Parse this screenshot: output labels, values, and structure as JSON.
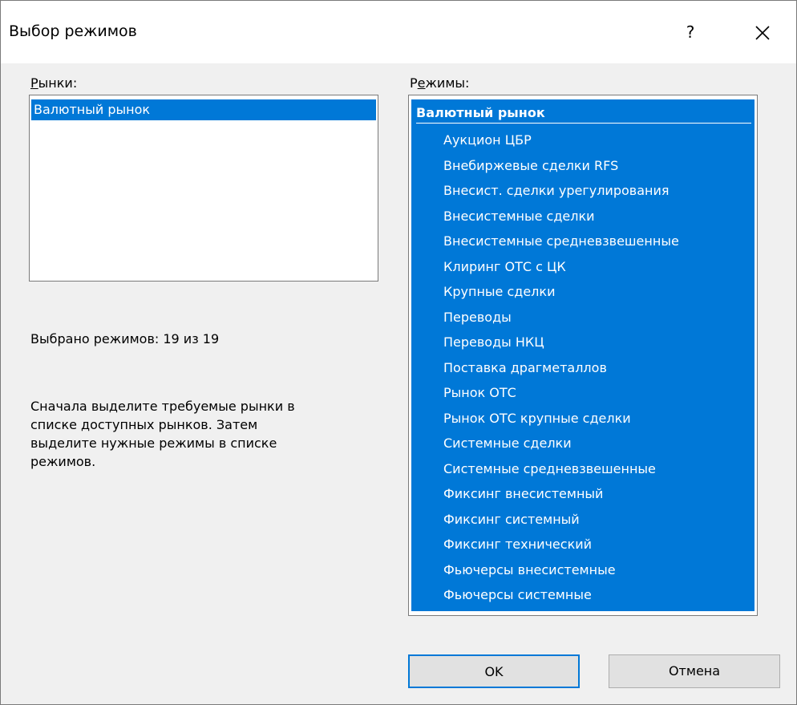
{
  "window": {
    "title": "Выбор режимов",
    "help_label": "?"
  },
  "markets": {
    "label_first": "Р",
    "label_rest": "ынки:",
    "items": [
      "Валютный рынок"
    ]
  },
  "modes": {
    "label_first": "Р",
    "label_underlined": "е",
    "label_rest": "жимы:",
    "group": "Валютный рынок",
    "items": [
      "Аукцион ЦБР",
      "Внебиржевые сделки RFS",
      "Внесист. сделки урегулирования",
      "Внесистемные сделки",
      "Внесистемные средневзвешенные",
      "Клиринг ОТС с ЦК",
      "Крупные сделки",
      "Переводы",
      "Переводы НКЦ",
      "Поставка драгметаллов",
      "Рынок ОТС",
      "Рынок ОТС крупные сделки",
      "Системные сделки",
      "Системные средневзвешенные",
      "Фиксинг внесистемный",
      "Фиксинг системный",
      "Фиксинг технический",
      "Фьючерсы внесистемные",
      "Фьючерсы системные"
    ]
  },
  "status": {
    "selected_text": "Выбрано режимов: 19 из 19"
  },
  "hint": {
    "lines": [
      "Сначала выделите требуемые рынки в",
      "списке доступных рынков. Затем",
      "выделите нужные режимы в списке",
      "режимов."
    ]
  },
  "buttons": {
    "ok": "OK",
    "cancel": "Отмена"
  },
  "colors": {
    "selection": "#0078d7",
    "dialog_bg": "#f0f0f0"
  }
}
